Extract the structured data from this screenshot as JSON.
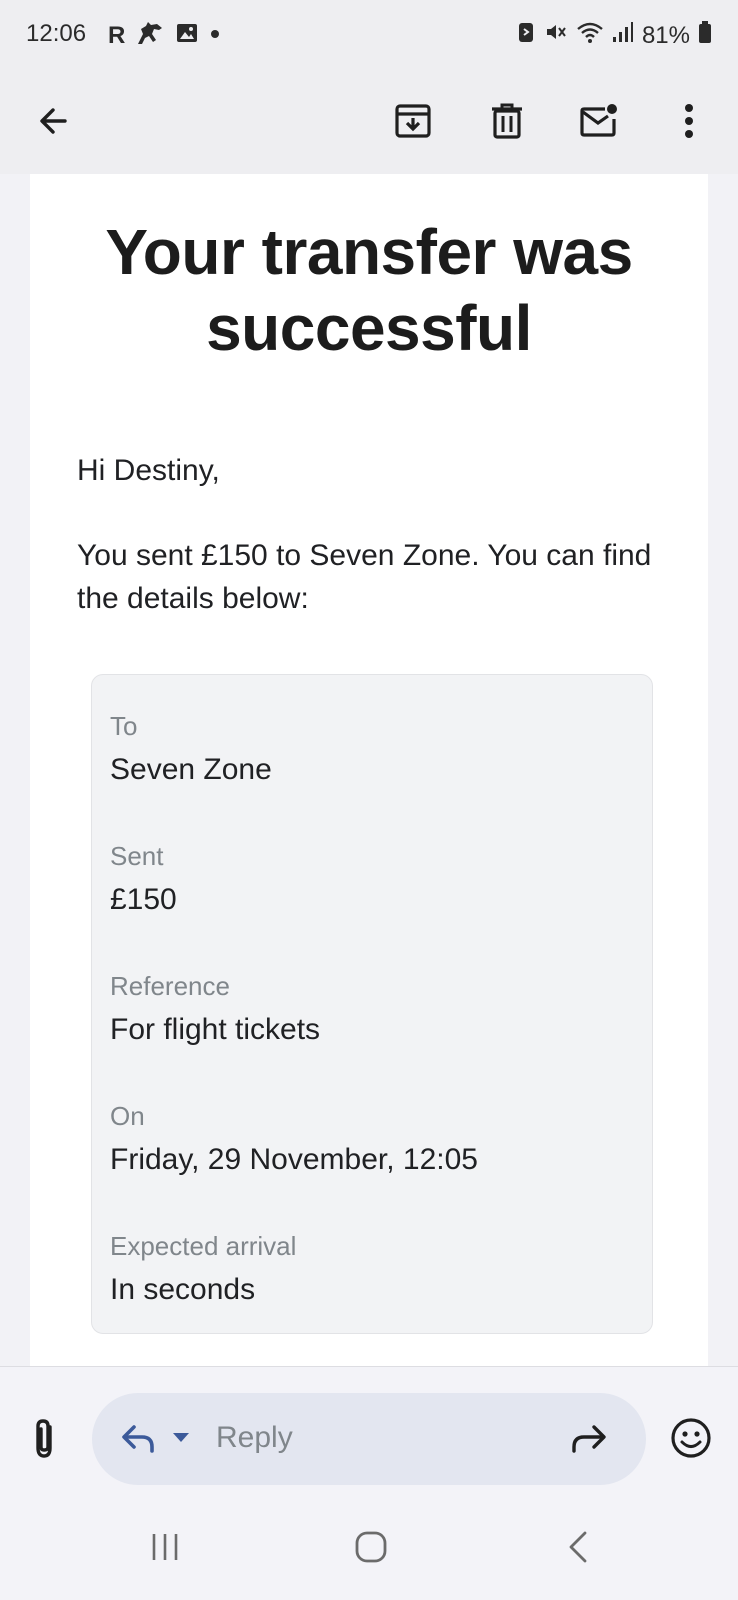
{
  "status_bar": {
    "time": "12:06",
    "carrier_letter": "R",
    "battery": "81%"
  },
  "toolbar": {
    "icons": [
      "back-arrow-icon",
      "archive-icon",
      "delete-icon",
      "mark-unread-icon",
      "more-vert-icon"
    ]
  },
  "email": {
    "headline": "Your transfer was successful",
    "greeting": "Hi Destiny,",
    "intro": "You sent £150 to Seven Zone. You can find the details below:",
    "details": [
      {
        "label": "To",
        "value": "Seven Zone"
      },
      {
        "label": "Sent",
        "value": "£150"
      },
      {
        "label": "Reference",
        "value": "For flight tickets"
      },
      {
        "label": "On",
        "value": "Friday, 29 November, 12:05"
      },
      {
        "label": "Expected arrival",
        "value": "In seconds"
      }
    ]
  },
  "reply_bar": {
    "placeholder": "Reply"
  },
  "colors": {
    "background": "#f2f2f6",
    "card": "#ffffff",
    "details_box": "#f2f3f5",
    "reply_pill": "#e3e6f0",
    "accent_blue": "#3c5a9a"
  }
}
